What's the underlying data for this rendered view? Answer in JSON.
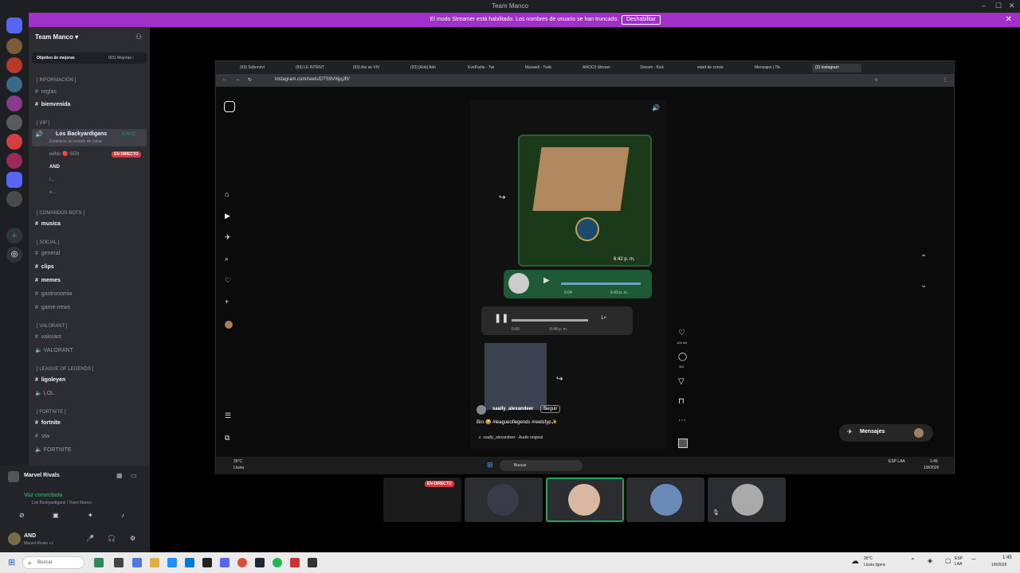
{
  "window": {
    "title": "Team Manco",
    "minimize": "–",
    "maximize": "☐",
    "close": "✕"
  },
  "banner": {
    "message": "El modo Streamer está habilitado. Los nombres de usuario se han truncado.",
    "button": "Deshabilitar",
    "close": "✕"
  },
  "server": {
    "name": "Team Manco ▾",
    "goal_label": "Objetivo de mejoras",
    "goal_value": "0/31 Mejoras ›"
  },
  "categories": {
    "info": "[ INFORMACIÓN ]",
    "vip": "[ VIP ]",
    "bots": "[ COMANDOS BOTS ]",
    "social": "[ SOCIAL ]",
    "valorant": "[ VALORANT ]",
    "lol": "[ LEAGUE OF LEGENDS ]",
    "fortnite": "[ FORTNITE ]"
  },
  "channels": {
    "reglas": "reglas",
    "bienvenida": "bienvenida",
    "backyardigans": "Los Backyardigans",
    "backyardigans_status": "Establece un estado de canal",
    "backyardigans_timer": "9:24:22",
    "user1": "eeNo 🔴 SEN",
    "live": "EN DIRECTO",
    "user2": "AND",
    "user3": "i...",
    "user4": "x...",
    "musica": "musica",
    "general": "general",
    "clips": "clips",
    "memes": "memes",
    "gastronomia": "gastronomia",
    "game_news": "game-news",
    "valorant_text": "valorant",
    "valorant_voice": "VALORANT",
    "ligoleyen": "ligoleyen",
    "lol_voice": "LOL",
    "fortnite_text": "fortnite",
    "stw": "stw",
    "fortnite_voice": "FORTNITE"
  },
  "user_panel": {
    "activity": "Marvel Rivals",
    "voice_status": "Voz conectada",
    "voice_channel": "Los Backyardigans / Team Manco",
    "username": "AND",
    "user_sub": "Marvel Rivals +1"
  },
  "browser": {
    "tabs": [
      "(93) Sobreviví",
      "(93) LE INTENT",
      "(93) Así se VIV",
      "(93) [Ado] Ado",
      "EvePartis - Twi",
      "Maxwell - Twitc",
      "ANOC0 Stream",
      "Stream - Kick",
      "edad de conse",
      "Mensajes | Tik",
      "(2) Instagram"
    ],
    "url": "instagram.com/reels/DTS9VI6jqJR/",
    "post": {
      "time1": "6:42 p. m.",
      "time2": "6:43 p. m.",
      "time3": "6:48 p. m.",
      "audio_dur": "0:04",
      "audio_dur2": "0:00",
      "speed": "1×",
      "username": "saally_alexandeer",
      "follow": "Seguir",
      "caption": "Bro 😂 #leagueoflegends #reelsfyp✨",
      "audio": "♬ saally_alexandeer · Audio original",
      "likes": "125 mil",
      "comments": "351"
    },
    "messages": "Mensajes",
    "inner_taskbar": {
      "weather_temp": "26°C",
      "weather_desc": "Lluvia",
      "search": "Buscar",
      "lang": "ESP\nLAA",
      "time": "1:45",
      "date": "1/8/2026"
    }
  },
  "stream_thumbs": {
    "live_badge": "EN DIRECTO"
  },
  "taskbar": {
    "search": "Buscar",
    "weather_temp": "26°C",
    "weather_desc": "Lluvia ligera",
    "lang": "ESP",
    "lang2": "LAA",
    "time": "1:45",
    "date": "1/8/2026"
  }
}
